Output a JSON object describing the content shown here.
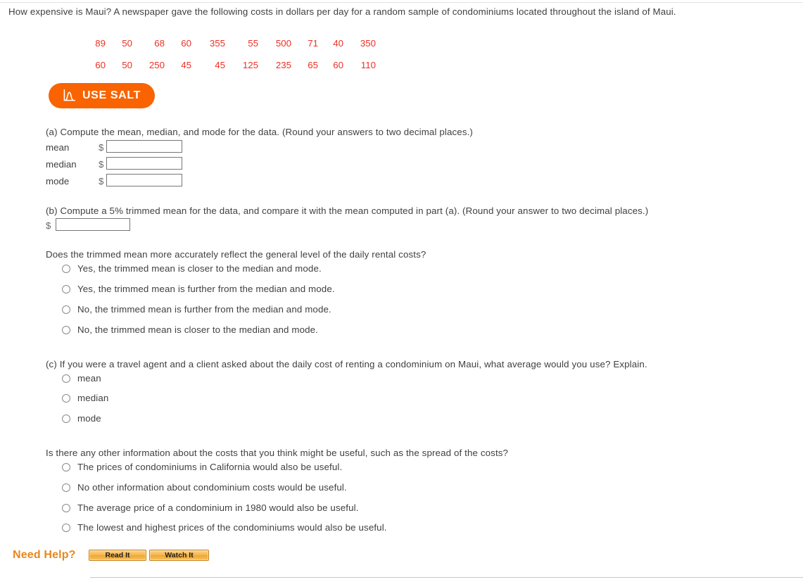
{
  "prompt": "How expensive is Maui? A newspaper gave the following costs in dollars per day for a random sample of condominiums located throughout the island of Maui.",
  "data_rows": [
    [
      "89",
      "50",
      "68",
      "60",
      "355",
      "55",
      "500",
      "71",
      "40",
      "350"
    ],
    [
      "60",
      "50",
      "250",
      "45",
      "45",
      "125",
      "235",
      "65",
      "60",
      "110"
    ]
  ],
  "salt_button": {
    "label": "USE SALT",
    "icon": "bell-curve-icon",
    "color": "#f96300"
  },
  "part_a": {
    "question": "(a) Compute the mean, median, and mode for the data. (Round your answers to two decimal places.)",
    "fields": [
      {
        "label": "mean",
        "currency": "$",
        "value": "",
        "placeholder": ""
      },
      {
        "label": "median",
        "currency": "$",
        "value": "",
        "placeholder": ""
      },
      {
        "label": "mode",
        "currency": "$",
        "value": "",
        "placeholder": ""
      }
    ]
  },
  "part_b": {
    "question": "(b) Compute a 5% trimmed mean for the data, and compare it with the mean computed in part (a). (Round your answer to two decimal places.)",
    "currency": "$",
    "value": "",
    "placeholder": "",
    "followup_question": "Does the trimmed mean more accurately reflect the general level of the daily rental costs?",
    "options": [
      "Yes, the trimmed mean is closer to the median and mode.",
      "Yes, the trimmed mean is further from the median and mode.",
      "No, the trimmed mean is further from the median and mode.",
      "No, the trimmed mean is closer to the median and mode."
    ]
  },
  "part_c": {
    "question": "(c) If you were a travel agent and a client asked about the daily cost of renting a condominium on Maui, what average would you use? Explain.",
    "options": [
      "mean",
      "median",
      "mode"
    ],
    "followup_question": "Is there any other information about the costs that you think might be useful, such as the spread of the costs?",
    "followup_options": [
      "The prices of condominiums in California would also be useful.",
      "No other information about condominium costs would be useful.",
      "The average price of a condominium in 1980 would also be useful.",
      "The lowest and highest prices of the condominiums would also be useful."
    ]
  },
  "footer": {
    "need_help_label": "Need Help?",
    "read_it_label": "Read It",
    "watch_it_label": "Watch It",
    "accent_color": "#e8871e"
  }
}
